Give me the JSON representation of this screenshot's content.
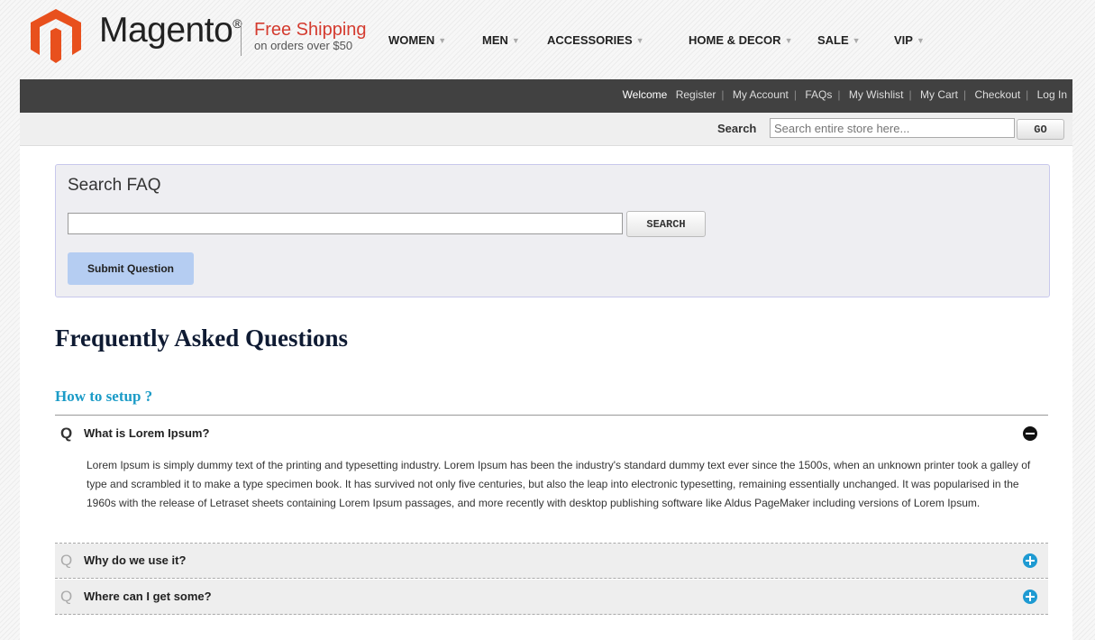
{
  "brand": {
    "name": "Magento",
    "mark": "®"
  },
  "promo": {
    "title": "Free Shipping",
    "subtitle": "on orders over $50"
  },
  "nav": {
    "items": [
      "WOMEN",
      "MEN",
      "ACCESSORIES",
      "HOME & DECOR",
      "SALE",
      "VIP"
    ]
  },
  "top_links": {
    "welcome": "Welcome",
    "links": [
      "Register",
      "My Account",
      "FAQs",
      "My Wishlist",
      "My Cart",
      "Checkout",
      "Log In"
    ]
  },
  "header_search": {
    "label": "Search",
    "placeholder": "Search entire store here...",
    "button": "GO"
  },
  "faq_search": {
    "title": "Search FAQ",
    "value": "",
    "search_button": "SEARCH",
    "submit_button": "Submit Question"
  },
  "faq": {
    "heading": "Frequently Asked Questions",
    "category": "How to setup ?",
    "questions": [
      {
        "mark": "Q",
        "question": "What is Lorem Ipsum?",
        "expanded": true,
        "toggle_icon": "minus-circle-icon",
        "answer": "Lorem Ipsum is simply dummy text of the printing and typesetting industry. Lorem Ipsum has been the industry's standard dummy text ever since the 1500s, when an unknown printer took a galley of type and scrambled it to make a type specimen book. It has survived not only five centuries, but also the leap into electronic typesetting, remaining essentially unchanged. It was popularised in the 1960s with the release of Letraset sheets containing Lorem Ipsum passages, and more recently with desktop publishing software like Aldus PageMaker including versions of Lorem Ipsum."
      },
      {
        "mark": "Q",
        "question": "Why do we use it?",
        "expanded": false,
        "toggle_icon": "plus-circle-icon"
      },
      {
        "mark": "Q",
        "question": "Where can I get some?",
        "expanded": false,
        "toggle_icon": "plus-circle-icon"
      }
    ]
  },
  "colors": {
    "brand_orange": "#e8501d",
    "promo_red": "#d43b2f",
    "topbar": "#414141",
    "accent_blue": "#1e9ad2",
    "category_blue": "#1b9bc7",
    "submit_button": "#b5cdf2"
  }
}
